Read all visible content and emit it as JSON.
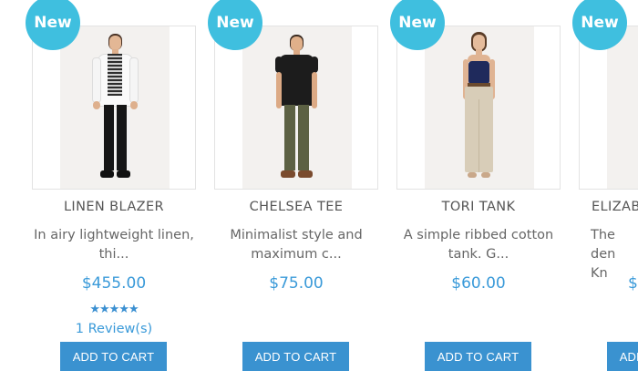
{
  "products": [
    {
      "badge": "New",
      "name": "LINEN BLAZER",
      "description": "In airy lightweight linen, thi...",
      "price": "$455.00",
      "stars": "★★★★★",
      "reviews": "1 Review(s)",
      "button": "ADD TO CART"
    },
    {
      "badge": "New",
      "name": "CHELSEA TEE",
      "description": "Minimalist style and maximum c...",
      "price": "$75.00",
      "button": "ADD TO CART"
    },
    {
      "badge": "New",
      "name": "TORI TANK",
      "description": "A simple ribbed cotton tank. G...",
      "price": "$60.00",
      "button": "ADD TO CART"
    },
    {
      "badge": "New",
      "name": "ELIZAB",
      "description": "The den Kn",
      "price": "$",
      "button": "ADD TO CART"
    }
  ],
  "colors": {
    "badge": "#3fbfdf",
    "price": "#3a9ad9",
    "button": "#3a92d0",
    "rating": "#3a8fd1"
  },
  "rating": {
    "value": 5,
    "max": 5
  }
}
